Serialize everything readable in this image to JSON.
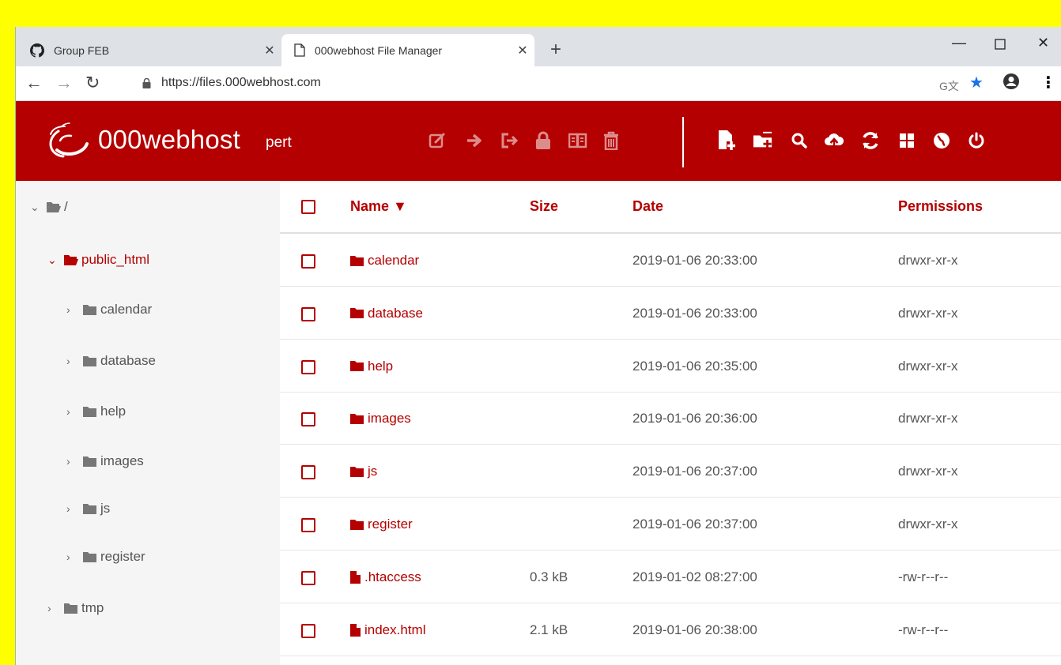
{
  "tabs": [
    {
      "title": "Group FEB",
      "icon": "github-icon"
    },
    {
      "title": "000webhost File Manager",
      "icon": "document-icon"
    }
  ],
  "address": {
    "url": "https://files.000webhost.com"
  },
  "app": {
    "brand": "000webhost",
    "user": "pert"
  },
  "toolbar": {
    "left_icons": [
      "edit-icon",
      "move-icon",
      "rename-icon",
      "lock-icon",
      "archive-icon",
      "trash-icon"
    ],
    "right_icons": [
      "new-file-icon",
      "new-folder-icon",
      "search-icon",
      "upload-icon",
      "refresh-icon",
      "grid-view-icon",
      "help-icon",
      "power-icon"
    ]
  },
  "tree": {
    "root": "/",
    "active": "public_html",
    "children": [
      "calendar",
      "database",
      "help",
      "images",
      "js",
      "register"
    ],
    "other": "tmp"
  },
  "table": {
    "headers": {
      "name": "Name ▼",
      "size": "Size",
      "date": "Date",
      "permissions": "Permissions"
    },
    "rows": [
      {
        "type": "folder",
        "name": "calendar",
        "size": "",
        "date": "2019-01-06 20:33:00",
        "permissions": "drwxr-xr-x"
      },
      {
        "type": "folder",
        "name": "database",
        "size": "",
        "date": "2019-01-06 20:33:00",
        "permissions": "drwxr-xr-x"
      },
      {
        "type": "folder",
        "name": "help",
        "size": "",
        "date": "2019-01-06 20:35:00",
        "permissions": "drwxr-xr-x"
      },
      {
        "type": "folder",
        "name": "images",
        "size": "",
        "date": "2019-01-06 20:36:00",
        "permissions": "drwxr-xr-x"
      },
      {
        "type": "folder",
        "name": "js",
        "size": "",
        "date": "2019-01-06 20:37:00",
        "permissions": "drwxr-xr-x"
      },
      {
        "type": "folder",
        "name": "register",
        "size": "",
        "date": "2019-01-06 20:37:00",
        "permissions": "drwxr-xr-x"
      },
      {
        "type": "file",
        "name": ".htaccess",
        "size": "0.3 kB",
        "date": "2019-01-02 08:27:00",
        "permissions": "-rw-r--r--"
      },
      {
        "type": "file",
        "name": "index.html",
        "size": "2.1 kB",
        "date": "2019-01-06 20:38:00",
        "permissions": "-rw-r--r--"
      }
    ]
  },
  "colors": {
    "brand": "#b40000",
    "highlight": "#ffff00"
  }
}
